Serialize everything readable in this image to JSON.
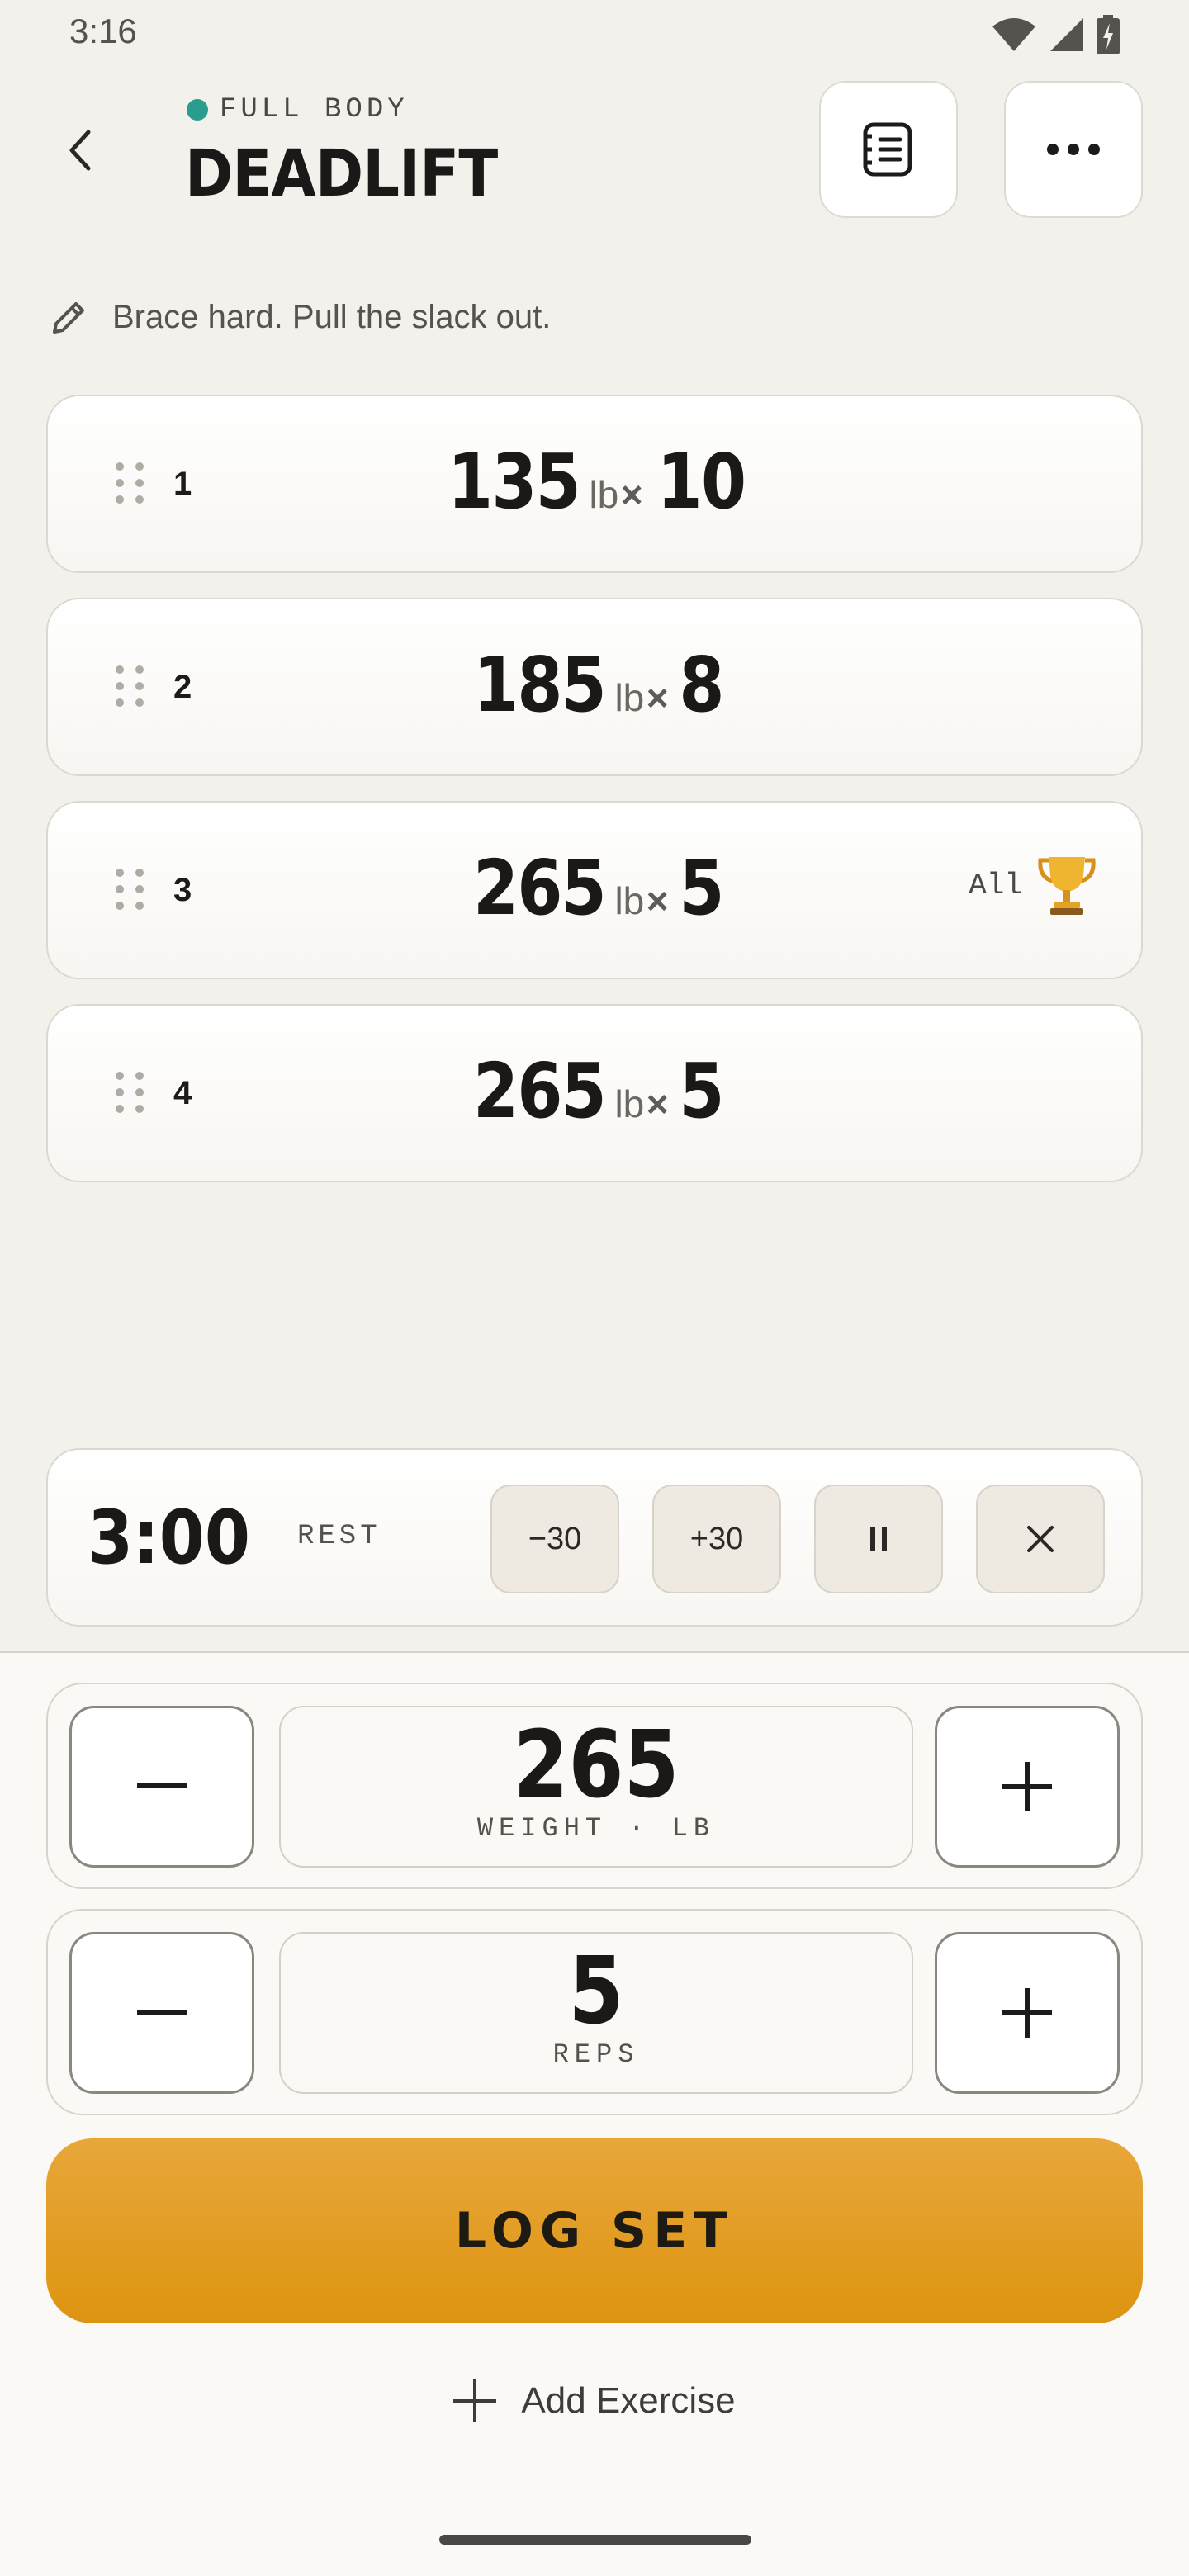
{
  "status_bar": {
    "time": "3:16"
  },
  "header": {
    "category": "FULL BODY",
    "category_color": "#2a9d8f",
    "title": "DEADLIFT",
    "back_icon": "chevron-left-icon",
    "notes_icon": "notes-icon",
    "more_icon": "more-horizontal-icon"
  },
  "note": {
    "text": "Brace hard. Pull the slack out."
  },
  "sets": [
    {
      "number": "1",
      "weight": "135",
      "unit": "lb",
      "times": "×",
      "reps": "10",
      "badge": ""
    },
    {
      "number": "2",
      "weight": "185",
      "unit": "lb",
      "times": "×",
      "reps": "8",
      "badge": ""
    },
    {
      "number": "3",
      "weight": "265",
      "unit": "lb",
      "times": "×",
      "reps": "5",
      "badge": "All"
    },
    {
      "number": "4",
      "weight": "265",
      "unit": "lb",
      "times": "×",
      "reps": "5",
      "badge": ""
    }
  ],
  "rest_timer": {
    "time": "3:00",
    "label": "REST",
    "minus_label": "−30",
    "plus_label": "+30"
  },
  "weight_stepper": {
    "value": "265",
    "caption": "WEIGHT · LB"
  },
  "reps_stepper": {
    "value": "5",
    "caption": "REPS"
  },
  "log_button": {
    "label": "LOG SET",
    "color": "#e29c1f"
  },
  "add_exercise": {
    "label": "Add Exercise"
  }
}
